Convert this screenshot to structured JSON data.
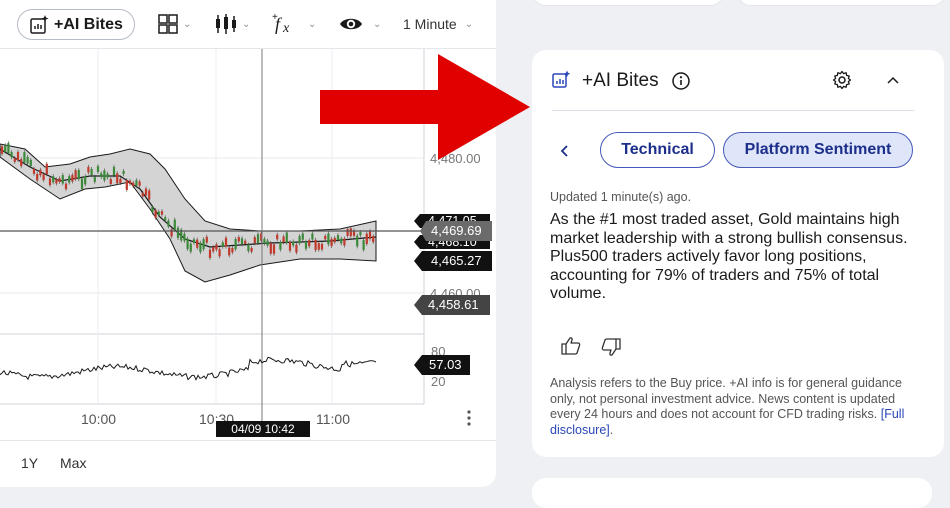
{
  "toolbar": {
    "ai_label": "+AI Bites",
    "timeframe": "1 Minute"
  },
  "chart": {
    "price_labels": [
      "4,480.00",
      "4,460.00"
    ],
    "price_badges": {
      "current": "4,469.69",
      "upper": "4,471.05",
      "middle": "4,468.10",
      "lower": "4,465.27",
      "low": "4,458.61"
    },
    "indicator_labels": [
      "80",
      "20"
    ],
    "indicator_badge": "57.03",
    "time_labels": [
      "10:00",
      "10:30",
      "11:00"
    ],
    "crosshair_time": "04/09 10:42"
  },
  "ranges": [
    "1Y",
    "Max"
  ],
  "panel": {
    "title": "+AI Bites",
    "tabs": [
      "Technical",
      "Platform Sentiment"
    ],
    "active_tab": "Platform Sentiment",
    "updated": "Updated 1 minute(s) ago.",
    "body": "As the #1 most traded asset, Gold maintains high market leadership with a strong bullish consensus. Plus500 traders actively favor long positions, accounting for 79% of traders and 75% of total volume.",
    "disclaimer": "Analysis refers to the Buy price. +AI info is for general guidance only, not personal investment advice. News content is updated every 24 hours and does not account for CFD trading risks.",
    "disclosure_link": "[Full disclosure]",
    "disclaimer_end": "."
  },
  "colors": {
    "accent": "#1c2f8a",
    "tab_active_bg": "#dfe6fa",
    "arrow": "#e00000",
    "candle_up": "#3a8a3a",
    "candle_down": "#c0392b",
    "badge_black": "#111111",
    "badge_grey": "#6b6b6b"
  },
  "icons": [
    "ai-chart-icon",
    "layout-grid-icon",
    "candles-icon",
    "fx-indicator-icon",
    "eye-icon",
    "info-icon",
    "gear-icon",
    "chevron-up-icon",
    "chevron-left-icon",
    "thumbs-up-icon",
    "thumbs-down-icon",
    "more-vertical-icon"
  ]
}
